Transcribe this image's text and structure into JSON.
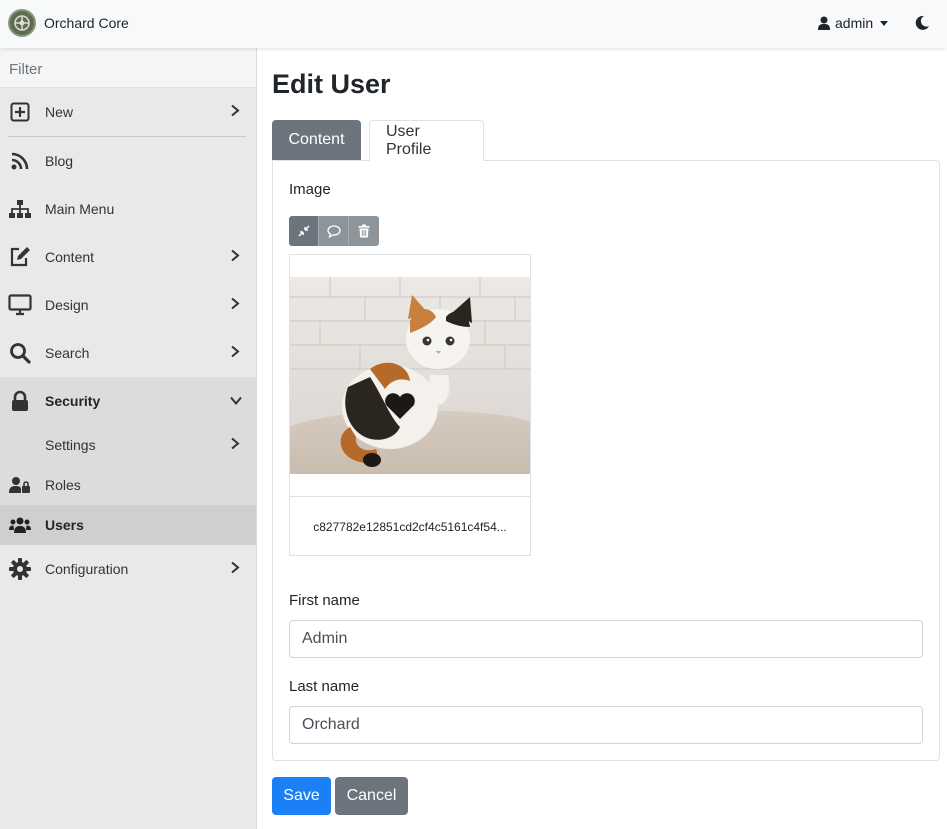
{
  "app": {
    "title": "Orchard Core"
  },
  "user_menu": {
    "label": "admin"
  },
  "sidebar": {
    "filter_placeholder": "Filter",
    "items": [
      {
        "label": "New",
        "icon": "plus-square-icon"
      },
      {
        "label": "Blog",
        "icon": "rss-icon"
      },
      {
        "label": "Main Menu",
        "icon": "sitemap-icon"
      },
      {
        "label": "Content",
        "icon": "edit-icon"
      },
      {
        "label": "Design",
        "icon": "monitor-icon"
      },
      {
        "label": "Search",
        "icon": "search-icon"
      },
      {
        "label": "Security",
        "icon": "lock-icon"
      },
      {
        "label": "Settings",
        "icon": ""
      },
      {
        "label": "Roles",
        "icon": "user-lock-icon"
      },
      {
        "label": "Users",
        "icon": "users-icon"
      },
      {
        "label": "Configuration",
        "icon": "gear-icon"
      }
    ]
  },
  "page": {
    "title": "Edit User"
  },
  "tabs": [
    {
      "label": "Content"
    },
    {
      "label": "User Profile"
    }
  ],
  "form": {
    "image_label": "Image",
    "image_filename": "c827782e12851cd2cf4c5161c4f54...",
    "first_name_label": "First name",
    "first_name_value": "Admin",
    "last_name_label": "Last name",
    "last_name_value": "Orchard"
  },
  "actions": {
    "save_label": "Save",
    "cancel_label": "Cancel"
  },
  "colors": {
    "primary": "#1b7ff5",
    "secondary": "#6c757d",
    "sidebar": "#e9e9e9"
  }
}
